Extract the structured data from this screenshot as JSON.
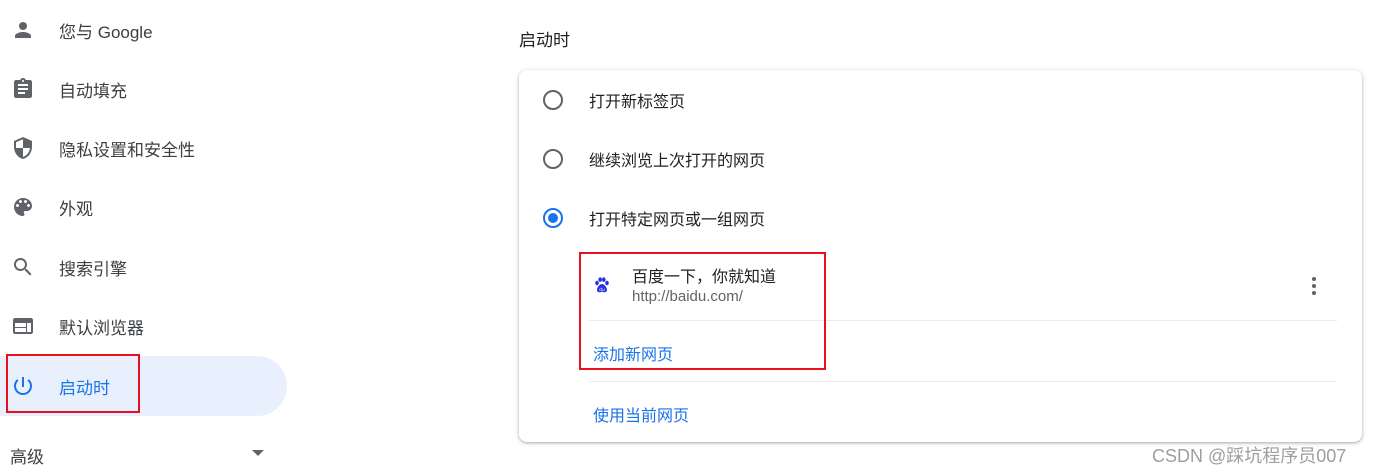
{
  "sidebar": {
    "items": [
      {
        "label": "您与 Google",
        "icon": "person-icon"
      },
      {
        "label": "自动填充",
        "icon": "clipboard-icon"
      },
      {
        "label": "隐私设置和安全性",
        "icon": "shield-icon"
      },
      {
        "label": "外观",
        "icon": "palette-icon"
      },
      {
        "label": "搜索引擎",
        "icon": "search-icon"
      },
      {
        "label": "默认浏览器",
        "icon": "browser-window-icon"
      },
      {
        "label": "启动时",
        "icon": "power-icon",
        "active": true
      }
    ],
    "advanced_label": "高级"
  },
  "main": {
    "section_title": "启动时",
    "options": [
      {
        "label": "打开新标签页",
        "checked": false
      },
      {
        "label": "继续浏览上次打开的网页",
        "checked": false
      },
      {
        "label": "打开特定网页或一组网页",
        "checked": true
      }
    ],
    "pages": [
      {
        "title": "百度一下，你就知道",
        "url": "http://baidu.com/",
        "icon": "baidu-paw-icon"
      }
    ],
    "add_page_label": "添加新网页",
    "use_current_label": "使用当前网页"
  },
  "watermark": "CSDN @踩坑程序员007",
  "colors": {
    "accent": "#1a73e8",
    "active_bg": "#e8f0fe",
    "highlight_border": "#e8101c",
    "baidu_blue": "#2932e1"
  }
}
